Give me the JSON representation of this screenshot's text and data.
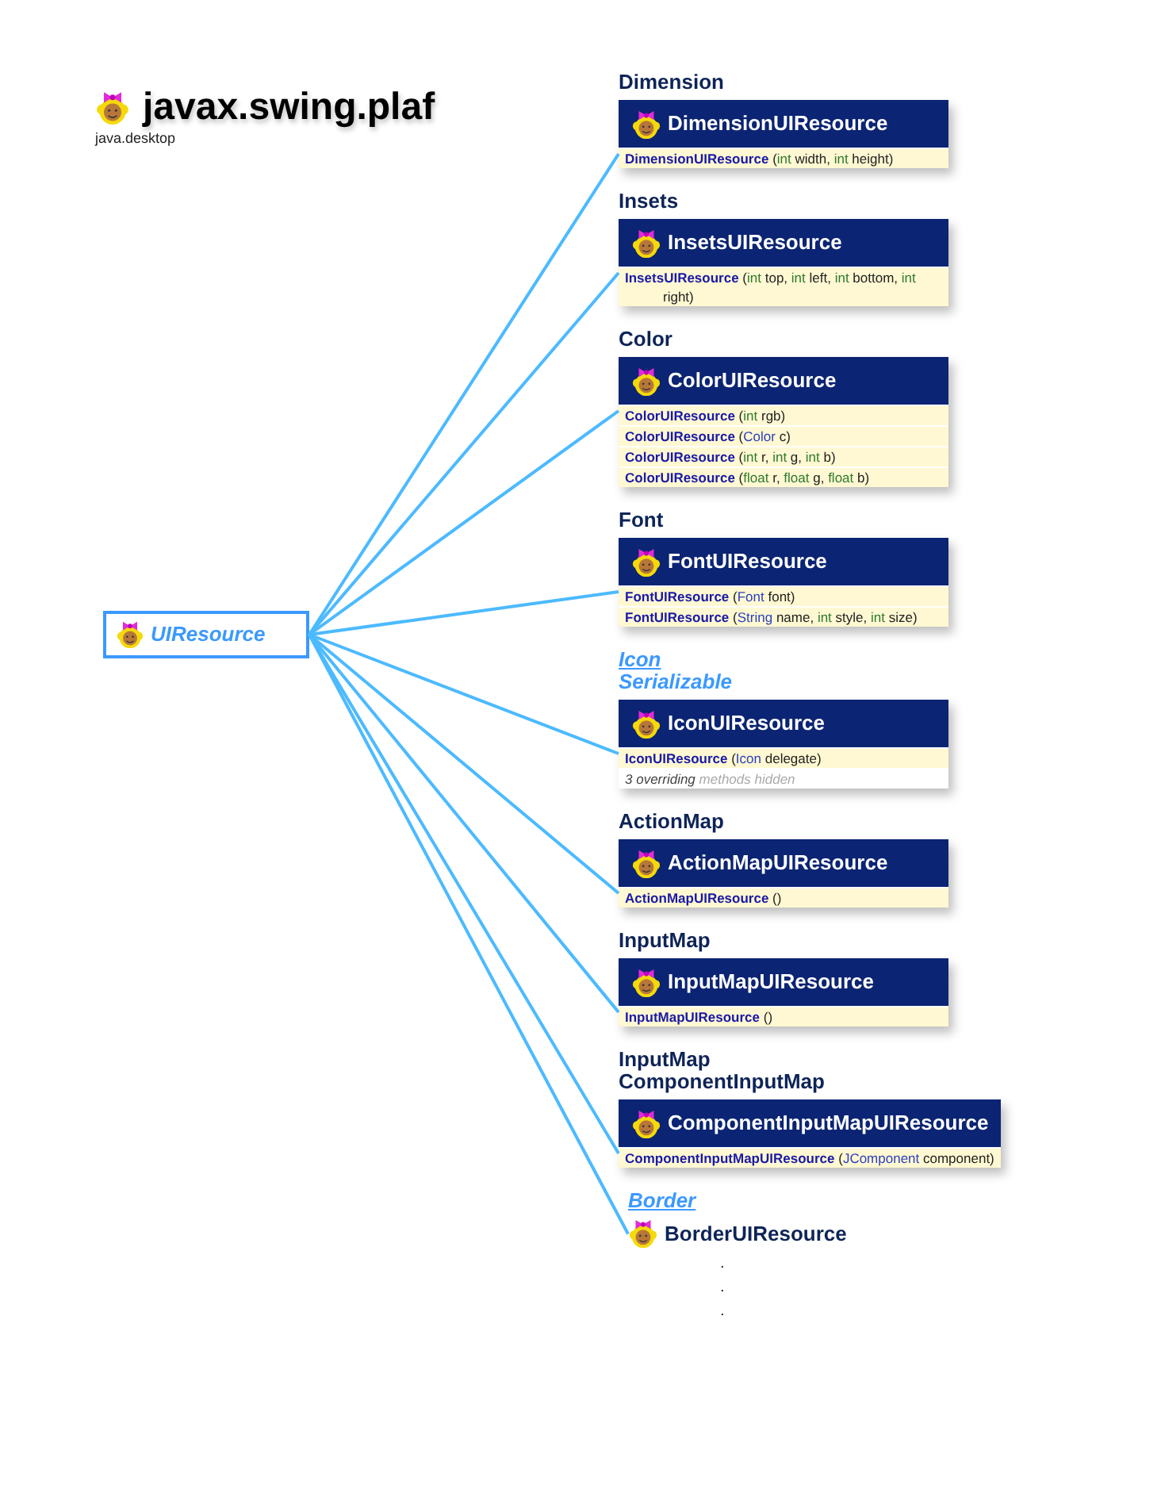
{
  "header": {
    "title": "javax.swing.plaf",
    "module": "java.desktop"
  },
  "root_class": {
    "name": "UIResource",
    "kind": "interface"
  },
  "groups": [
    {
      "supers": [
        {
          "name": "Dimension",
          "kind": "class",
          "link": false
        }
      ],
      "title": "DimensionUIResource",
      "rows": [
        {
          "kind": "constructor",
          "parts": [
            {
              "text": "DimensionUIResource",
              "kind": "name"
            },
            {
              "text": " (",
              "kind": "plain"
            },
            {
              "text": "int",
              "kind": "primitive"
            },
            {
              "text": " width, ",
              "kind": "plain"
            },
            {
              "text": "int",
              "kind": "primitive"
            },
            {
              "text": " height)",
              "kind": "plain"
            }
          ]
        }
      ]
    },
    {
      "supers": [
        {
          "name": "Insets",
          "kind": "class",
          "link": false
        }
      ],
      "title": "InsetsUIResource",
      "rows": [
        {
          "kind": "constructor",
          "parts": [
            {
              "text": "InsetsUIResource",
              "kind": "name"
            },
            {
              "text": " (",
              "kind": "plain"
            },
            {
              "text": "int",
              "kind": "primitive"
            },
            {
              "text": " top, ",
              "kind": "plain"
            },
            {
              "text": "int",
              "kind": "primitive"
            },
            {
              "text": " left, ",
              "kind": "plain"
            },
            {
              "text": "int",
              "kind": "primitive"
            },
            {
              "text": " bottom, ",
              "kind": "plain"
            },
            {
              "text": "int",
              "kind": "primitive"
            },
            {
              "text": " right)",
              "kind": "plain"
            }
          ]
        }
      ]
    },
    {
      "supers": [
        {
          "name": "Color",
          "kind": "class",
          "link": false
        }
      ],
      "title": "ColorUIResource",
      "rows": [
        {
          "kind": "constructor",
          "parts": [
            {
              "text": "ColorUIResource",
              "kind": "name"
            },
            {
              "text": " (",
              "kind": "plain"
            },
            {
              "text": "int",
              "kind": "primitive"
            },
            {
              "text": " rgb)",
              "kind": "plain"
            }
          ]
        },
        {
          "kind": "constructor",
          "parts": [
            {
              "text": "ColorUIResource",
              "kind": "name"
            },
            {
              "text": " (",
              "kind": "plain"
            },
            {
              "text": "Color",
              "kind": "type"
            },
            {
              "text": " c)",
              "kind": "plain"
            }
          ]
        },
        {
          "kind": "constructor",
          "parts": [
            {
              "text": "ColorUIResource",
              "kind": "name"
            },
            {
              "text": " (",
              "kind": "plain"
            },
            {
              "text": "int",
              "kind": "primitive"
            },
            {
              "text": " r, ",
              "kind": "plain"
            },
            {
              "text": "int",
              "kind": "primitive"
            },
            {
              "text": " g, ",
              "kind": "plain"
            },
            {
              "text": "int",
              "kind": "primitive"
            },
            {
              "text": " b)",
              "kind": "plain"
            }
          ]
        },
        {
          "kind": "constructor",
          "parts": [
            {
              "text": "ColorUIResource",
              "kind": "name"
            },
            {
              "text": " (",
              "kind": "plain"
            },
            {
              "text": "float",
              "kind": "primitive"
            },
            {
              "text": " r, ",
              "kind": "plain"
            },
            {
              "text": "float",
              "kind": "primitive"
            },
            {
              "text": " g, ",
              "kind": "plain"
            },
            {
              "text": "float",
              "kind": "primitive"
            },
            {
              "text": " b)",
              "kind": "plain"
            }
          ]
        }
      ]
    },
    {
      "supers": [
        {
          "name": "Font",
          "kind": "class",
          "link": false
        }
      ],
      "title": "FontUIResource",
      "rows": [
        {
          "kind": "constructor",
          "parts": [
            {
              "text": "FontUIResource",
              "kind": "name"
            },
            {
              "text": " (",
              "kind": "plain"
            },
            {
              "text": "Font",
              "kind": "type"
            },
            {
              "text": " font)",
              "kind": "plain"
            }
          ]
        },
        {
          "kind": "constructor",
          "parts": [
            {
              "text": "FontUIResource",
              "kind": "name"
            },
            {
              "text": " (",
              "kind": "plain"
            },
            {
              "text": "String",
              "kind": "type"
            },
            {
              "text": " name, ",
              "kind": "plain"
            },
            {
              "text": "int",
              "kind": "primitive"
            },
            {
              "text": " style, ",
              "kind": "plain"
            },
            {
              "text": "int",
              "kind": "primitive"
            },
            {
              "text": " size)",
              "kind": "plain"
            }
          ]
        }
      ]
    },
    {
      "supers": [
        {
          "name": "Icon",
          "kind": "interface",
          "link": true
        },
        {
          "name": "Serializable",
          "kind": "interface",
          "link": false
        }
      ],
      "title": "IconUIResource",
      "rows": [
        {
          "kind": "constructor",
          "parts": [
            {
              "text": "IconUIResource",
              "kind": "name"
            },
            {
              "text": " (",
              "kind": "plain"
            },
            {
              "text": "Icon",
              "kind": "type"
            },
            {
              "text": " delegate)",
              "kind": "plain"
            }
          ]
        },
        {
          "kind": "note",
          "parts": [
            {
              "text": "3 overriding",
              "kind": "note-strong"
            },
            {
              "text": " methods hidden",
              "kind": "note-faint"
            }
          ]
        }
      ]
    },
    {
      "supers": [
        {
          "name": "ActionMap",
          "kind": "class",
          "link": false
        }
      ],
      "title": "ActionMapUIResource",
      "rows": [
        {
          "kind": "constructor",
          "parts": [
            {
              "text": "ActionMapUIResource",
              "kind": "name"
            },
            {
              "text": " ()",
              "kind": "plain"
            }
          ]
        }
      ]
    },
    {
      "supers": [
        {
          "name": "InputMap",
          "kind": "class",
          "link": false
        }
      ],
      "title": "InputMapUIResource",
      "rows": [
        {
          "kind": "constructor",
          "parts": [
            {
              "text": "InputMapUIResource",
              "kind": "name"
            },
            {
              "text": " ()",
              "kind": "plain"
            }
          ]
        }
      ]
    },
    {
      "supers": [
        {
          "name": "InputMap",
          "kind": "class",
          "link": false
        },
        {
          "name": "ComponentInputMap",
          "kind": "class",
          "link": false
        }
      ],
      "title": "ComponentInputMapUIResource",
      "rows": [
        {
          "kind": "constructor",
          "parts": [
            {
              "text": "ComponentInputMapUIResource",
              "kind": "name"
            },
            {
              "text": " (",
              "kind": "plain"
            },
            {
              "text": "JComponent",
              "kind": "type"
            },
            {
              "text": " component)",
              "kind": "plain"
            }
          ]
        }
      ]
    },
    {
      "supers": [
        {
          "name": "Border",
          "kind": "interface",
          "link": true
        }
      ],
      "title": "BorderUIResource"
    }
  ],
  "ellipsis": [
    ".",
    ".",
    "."
  ]
}
